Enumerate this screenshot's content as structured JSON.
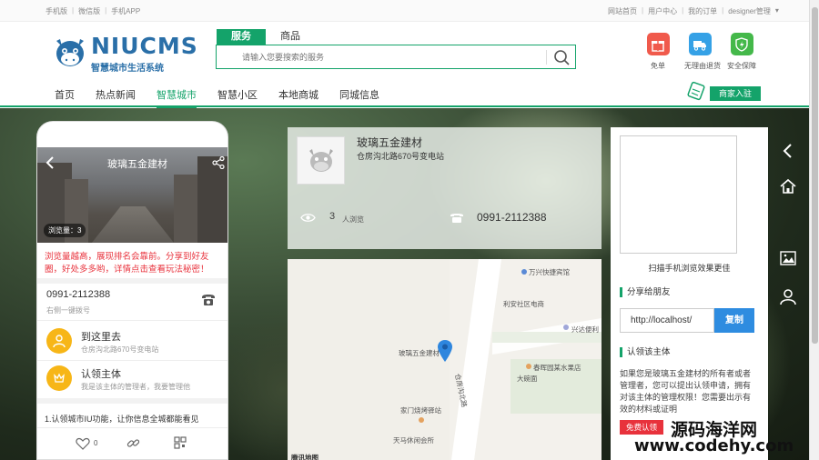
{
  "topbar": {
    "left": [
      "手机版",
      "微信版",
      "手机APP"
    ],
    "right": [
      "网站首页",
      "用户中心",
      "我的订单",
      "designer管理"
    ],
    "sep": "|"
  },
  "logo": {
    "brand": "NIUCMS",
    "slogan": "智慧城市生活系统"
  },
  "search": {
    "tabs": [
      "服务",
      "商品"
    ],
    "placeholder": "请输入您要搜索的服务"
  },
  "quick_icons": [
    {
      "label": "免单",
      "color": "#f05a4c",
      "icon": "gift-icon"
    },
    {
      "label": "无理由退货",
      "color": "#35a1e6",
      "icon": "truck-icon"
    },
    {
      "label": "安全保障",
      "color": "#44b84a",
      "icon": "shield-icon"
    }
  ],
  "nav": {
    "items": [
      "首页",
      "热点新闻",
      "智慧城市",
      "智慧小区",
      "本地商城",
      "同城信息"
    ],
    "join": "商家入驻"
  },
  "phone": {
    "title": "玻璃五金建材",
    "views": "浏览量：3",
    "notice": "浏览量越高，展现排名会靠前。分享到好友圈，好处多多哟，详情点击查看玩法秘密！",
    "tel": "0991-2112388",
    "tel_sub": "右侧一键拨号",
    "go_title": "到这里去",
    "go_sub": "仓房沟北路670号变电站",
    "claim_title": "认领主体",
    "claim_sub": "我是该主体的管理者，我要管理他",
    "bottom_text": "1.认领城市IU功能，让你信息全城都能看见",
    "likes": "0"
  },
  "info": {
    "name": "玻璃五金建材",
    "address": "仓房沟北路670号变电站",
    "views": "3",
    "views_label": "人浏览",
    "phone": "0991-2112388"
  },
  "map": {
    "labels": [
      "万兴快捷宾馆",
      "利安社区电商",
      "兴达便利",
      "玻璃五金建材",
      "春晖园某水果店",
      "大碗面",
      "家门烧烤驿站",
      "天马休闲会所",
      "腾讯地图",
      "仓房沟北路"
    ]
  },
  "sidebar": {
    "qr_caption": "扫描手机浏览效果更佳",
    "share_title": "分享给朋友",
    "url": "http://localhost/",
    "copy": "复制",
    "claim_title": "认领该主体",
    "claim_text": "如果您是玻璃五金建材的所有者或者管理者，您可以提出认领申请，拥有对该主体的管理权限！您需要出示有效的材料或证明",
    "claim_btn": "免费认领"
  },
  "watermark": {
    "cn": "源码海洋网",
    "en": "www.codehy.com"
  },
  "colors": {
    "accent": "#14a36a",
    "alert": "#e8323c",
    "blue": "#2e8ce0",
    "brand": "#2a6fa8"
  }
}
